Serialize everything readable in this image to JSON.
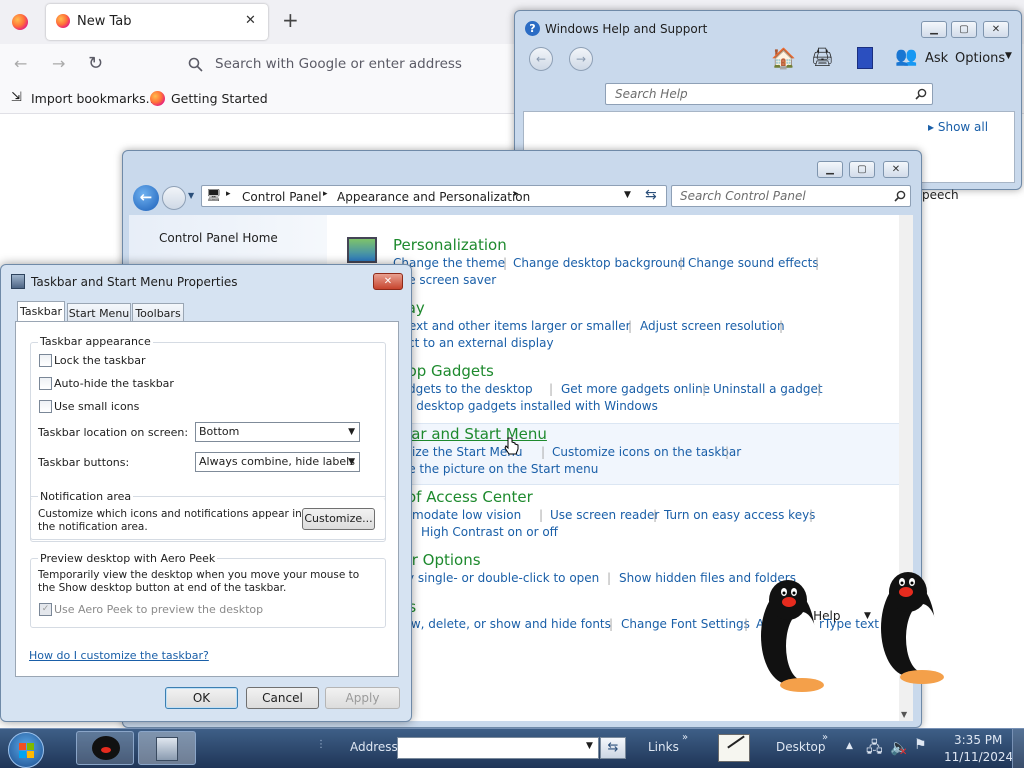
{
  "firefox": {
    "tab_title": "New Tab",
    "new_tab": "+",
    "close_tab": "✕",
    "search_placeholder": "Search with Google or enter address",
    "bookmarks": [
      "Import bookmarks...",
      "Getting Started"
    ]
  },
  "help": {
    "title": "Windows Help and Support",
    "ask": "Ask",
    "options": "Options",
    "search_placeholder": "Search Help",
    "show_all": "Show all",
    "peech": "peech",
    "online_help": "ine Help"
  },
  "cp": {
    "breadcrumb": [
      "Control Panel",
      "Appearance and Personalization"
    ],
    "search_placeholder": "Search Control Panel",
    "home": "Control Panel Home",
    "sections": [
      {
        "title": "Personalization",
        "links": [
          [
            "Change the theme",
            "Change desktop background",
            "Change sound effects"
          ],
          [
            "nge screen saver"
          ]
        ]
      },
      {
        "title": "play",
        "links": [
          [
            "e text and other items larger or smaller",
            "Adjust screen resolution"
          ],
          [
            "nect to an external display"
          ]
        ]
      },
      {
        "title": "ktop Gadgets",
        "links": [
          [
            "gadgets to the desktop",
            "Get more gadgets online",
            "Uninstall a gadget"
          ],
          [
            "ore desktop gadgets installed with Windows"
          ]
        ]
      },
      {
        "title": "kbar and Start Menu",
        "links": [
          [
            "omize the Start Menu",
            "Customize icons on the taskbar"
          ],
          [
            "nge the picture on the Start menu"
          ]
        ]
      },
      {
        "title": "e of Access Center",
        "links": [
          [
            "ommodate low vision",
            "Use screen reader",
            "Turn on easy access keys"
          ],
          [
            "High Contrast on or off"
          ]
        ]
      },
      {
        "title": "der Options",
        "links": [
          [
            "cify single- or double-click to open",
            "Show hidden files and folders"
          ]
        ]
      },
      {
        "title": "nts",
        "links": [
          [
            "view, delete, or show and hide fonts",
            "Change Font Settings",
            "A",
            "rType text"
          ]
        ]
      }
    ]
  },
  "dialog": {
    "title": "Taskbar and Start Menu Properties",
    "tabs": [
      "Taskbar",
      "Start Menu",
      "Toolbars"
    ],
    "appearance_label": "Taskbar appearance",
    "checkboxes": [
      "Lock the taskbar",
      "Auto-hide the taskbar",
      "Use small icons"
    ],
    "location_label": "Taskbar location on screen:",
    "location_value": "Bottom",
    "buttons_label": "Taskbar buttons:",
    "buttons_value": "Always combine, hide labels",
    "notif_label": "Notification area",
    "notif_text": "Customize which icons and notifications appear in the notification area.",
    "customize": "Customize...",
    "peek_label": "Preview desktop with Aero Peek",
    "peek_text": "Temporarily view the desktop when you move your mouse to the Show desktop button at end of the taskbar.",
    "peek_checkbox": "Use Aero Peek to preview the desktop",
    "help_link": "How do I customize the taskbar?",
    "ok": "OK",
    "cancel": "Cancel",
    "apply": "Apply"
  },
  "taskbar": {
    "address": "Address",
    "links": "Links",
    "desktop": "Desktop",
    "time": "3:35 PM",
    "date": "11/11/2024"
  }
}
